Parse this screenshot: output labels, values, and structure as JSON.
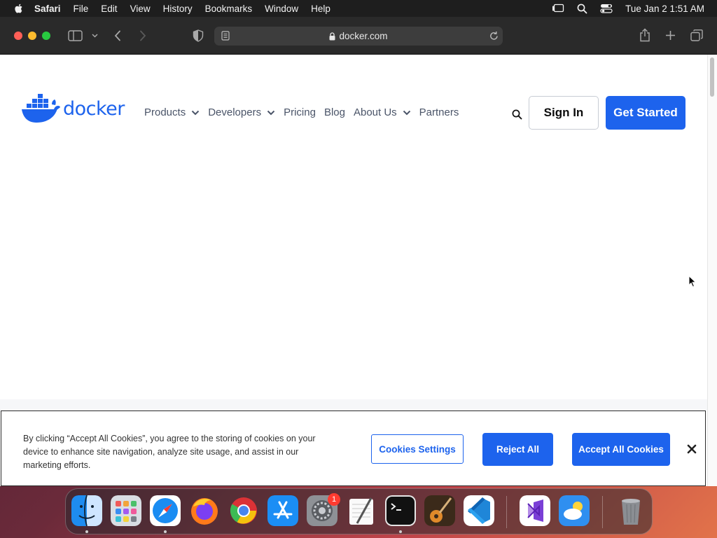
{
  "menubar": {
    "app": "Safari",
    "items": [
      "File",
      "Edit",
      "View",
      "History",
      "Bookmarks",
      "Window",
      "Help"
    ],
    "clock": "Tue Jan 2  1:51 AM"
  },
  "browser": {
    "url": "docker.com"
  },
  "site": {
    "logo_text": "docker",
    "nav": {
      "products": "Products",
      "developers": "Developers",
      "pricing": "Pricing",
      "blog": "Blog",
      "about": "About Us",
      "partners": "Partners"
    },
    "sign_in": "Sign In",
    "get_started": "Get Started",
    "brand_color": "#1d63ed"
  },
  "cookie_banner": {
    "text": "By clicking “Accept All Cookies”, you agree to the storing of cookies on your device to enhance site navigation, analyze site usage, and assist in our marketing efforts.",
    "settings_label": "Cookies Settings",
    "reject_label": "Reject All",
    "accept_label": "Accept All Cookies"
  },
  "dock": {
    "apps": [
      "finder-icon",
      "launchpad-icon",
      "safari-icon",
      "firefox-icon",
      "chrome-icon",
      "app-store-icon",
      "system-settings-icon",
      "textedit-icon",
      "terminal-icon",
      "garageband-icon",
      "vscode-icon",
      "visual-studio-icon",
      "weather-icon",
      "trash-icon"
    ],
    "settings_badge": "1"
  }
}
